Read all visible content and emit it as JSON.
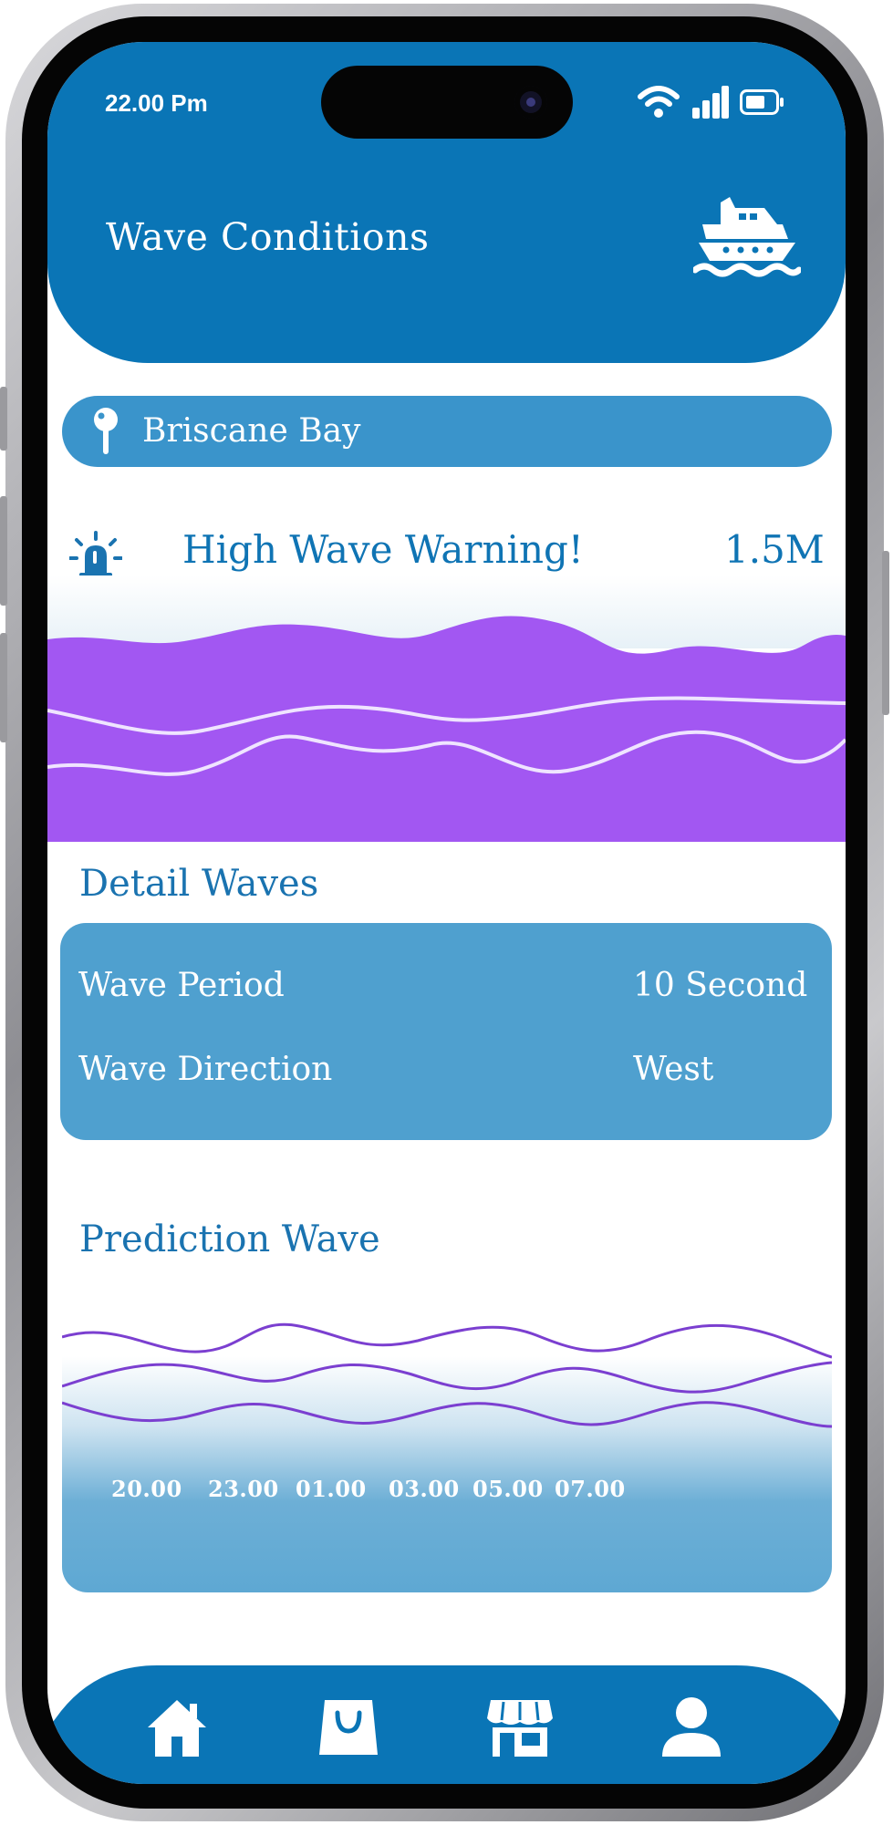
{
  "status_bar": {
    "time": "22.00 Pm",
    "icons": [
      "wifi-icon",
      "cellular-signal-icon",
      "battery-icon"
    ]
  },
  "header": {
    "title": "Wave Conditions",
    "icon": "boat-icon",
    "background": "#0a75b6"
  },
  "location": {
    "name": "Briscane Bay",
    "icon": "location-pin-icon"
  },
  "warning": {
    "text": "High Wave Warning!",
    "value": "1.5M",
    "icon": "alarm-siren-icon",
    "wave_color": "#a257f2"
  },
  "details": {
    "title": "Detail Waves",
    "rows": [
      {
        "label": "Wave Period",
        "value": "10 Second"
      },
      {
        "label": "Wave Direction",
        "value": "West"
      }
    ]
  },
  "prediction": {
    "title": "Prediction Wave",
    "times": [
      "20.00",
      "23.00",
      "01.00",
      "03.00",
      "05.00",
      "07.00"
    ],
    "line_color": "#7b3fd0"
  },
  "nav": {
    "items": [
      {
        "name": "home",
        "icon": "home-icon"
      },
      {
        "name": "shop",
        "icon": "shopping-bag-icon"
      },
      {
        "name": "store",
        "icon": "store-icon"
      },
      {
        "name": "profile",
        "icon": "user-icon"
      }
    ]
  }
}
